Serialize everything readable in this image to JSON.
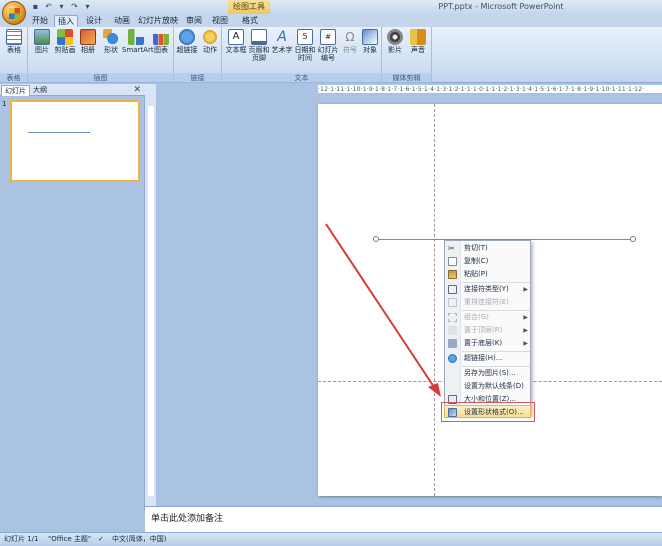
{
  "window": {
    "title": "PPT.pptx - Microsoft PowerPoint",
    "context_tab": "绘图工具"
  },
  "tabs": [
    {
      "label": "开始",
      "active": false
    },
    {
      "label": "插入",
      "active": true
    },
    {
      "label": "设计",
      "active": false
    },
    {
      "label": "动画",
      "active": false
    },
    {
      "label": "幻灯片放映",
      "active": false
    },
    {
      "label": "审阅",
      "active": false
    },
    {
      "label": "视图",
      "active": false
    },
    {
      "label": "格式",
      "active": false
    }
  ],
  "ribbon": {
    "groups": [
      {
        "label": "表格",
        "buttons": [
          {
            "label": "表格",
            "icon": "table-icon"
          }
        ]
      },
      {
        "label": "插图",
        "buttons": [
          {
            "label": "图片",
            "icon": "picture-icon"
          },
          {
            "label": "剪贴画",
            "icon": "clipart-icon"
          },
          {
            "label": "相册",
            "icon": "album-icon"
          },
          {
            "label": "形状",
            "icon": "shapes-icon"
          },
          {
            "label": "SmartArt",
            "icon": "smartart-icon"
          },
          {
            "label": "图表",
            "icon": "chart-icon"
          }
        ]
      },
      {
        "label": "链接",
        "buttons": [
          {
            "label": "超链接",
            "icon": "hyperlink-icon"
          },
          {
            "label": "动作",
            "icon": "action-icon"
          }
        ]
      },
      {
        "label": "文本",
        "buttons": [
          {
            "label": "文本框",
            "icon": "textbox-icon"
          },
          {
            "label": "页眉和页脚",
            "icon": "header-footer-icon"
          },
          {
            "label": "艺术字",
            "icon": "wordart-icon"
          },
          {
            "label": "日期和时间",
            "icon": "datetime-icon"
          },
          {
            "label": "幻灯片编号",
            "icon": "slide-number-icon"
          },
          {
            "label": "符号",
            "icon": "symbol-icon"
          },
          {
            "label": "对象",
            "icon": "object-icon"
          }
        ]
      },
      {
        "label": "媒体剪辑",
        "buttons": [
          {
            "label": "影片",
            "icon": "movie-icon"
          },
          {
            "label": "声音",
            "icon": "sound-icon"
          }
        ]
      }
    ]
  },
  "left_panel": {
    "tabs": [
      "幻灯片",
      "大纲"
    ],
    "slide_number": "1"
  },
  "ruler": {
    "h_text": "·12·1·11·1·10·1·9·1·8·1·7·1·6·1·5·1·4·1·3·1·2·1·1·1·0·1·1·1·2·1·3·1·4·1·5·1·6·1·7·1·8·1·9·1·10·1·11·1·12·"
  },
  "context_menu": {
    "items": [
      {
        "label": "剪切(T)",
        "icon": "scissors-icon",
        "disabled": false,
        "submenu": false
      },
      {
        "label": "复制(C)",
        "icon": "copy-icon",
        "disabled": false,
        "submenu": false
      },
      {
        "label": "粘贴(P)",
        "icon": "paste-icon",
        "disabled": false,
        "submenu": false
      },
      {
        "sep": true
      },
      {
        "label": "连接符类型(Y)",
        "icon": "connector-icon",
        "disabled": false,
        "submenu": true
      },
      {
        "label": "重排连接符(E)",
        "icon": "reroute-icon",
        "disabled": true,
        "submenu": false
      },
      {
        "sep": true
      },
      {
        "label": "组合(G)",
        "icon": "group-icon",
        "disabled": true,
        "submenu": true
      },
      {
        "label": "置于顶层(R)",
        "icon": "bring-front-icon",
        "disabled": true,
        "submenu": true
      },
      {
        "label": "置于底层(K)",
        "icon": "send-back-icon",
        "disabled": false,
        "submenu": true
      },
      {
        "sep": true
      },
      {
        "label": "超链接(H)...",
        "icon": "hyperlink-icon",
        "disabled": false,
        "submenu": false
      },
      {
        "sep": true
      },
      {
        "label": "另存为图片(S)...",
        "icon": "",
        "disabled": false,
        "submenu": false
      },
      {
        "label": "设置为默认线条(D)",
        "icon": "",
        "disabled": false,
        "submenu": false
      },
      {
        "label": "大小和位置(Z)...",
        "icon": "size-icon",
        "disabled": false,
        "submenu": false
      },
      {
        "label": "设置形状格式(O)...",
        "icon": "format-shape-icon",
        "disabled": false,
        "submenu": false,
        "highlight": true
      }
    ]
  },
  "notes": {
    "placeholder": "单击此处添加备注"
  },
  "status": {
    "slide": "幻灯片 1/1",
    "theme": "\"Office 主题\"",
    "language": "中文(简体，中国)"
  },
  "colors": {
    "accent": "#f3b04b",
    "arrow": "#d83a3a",
    "highlight_box": "#d25b5b"
  }
}
